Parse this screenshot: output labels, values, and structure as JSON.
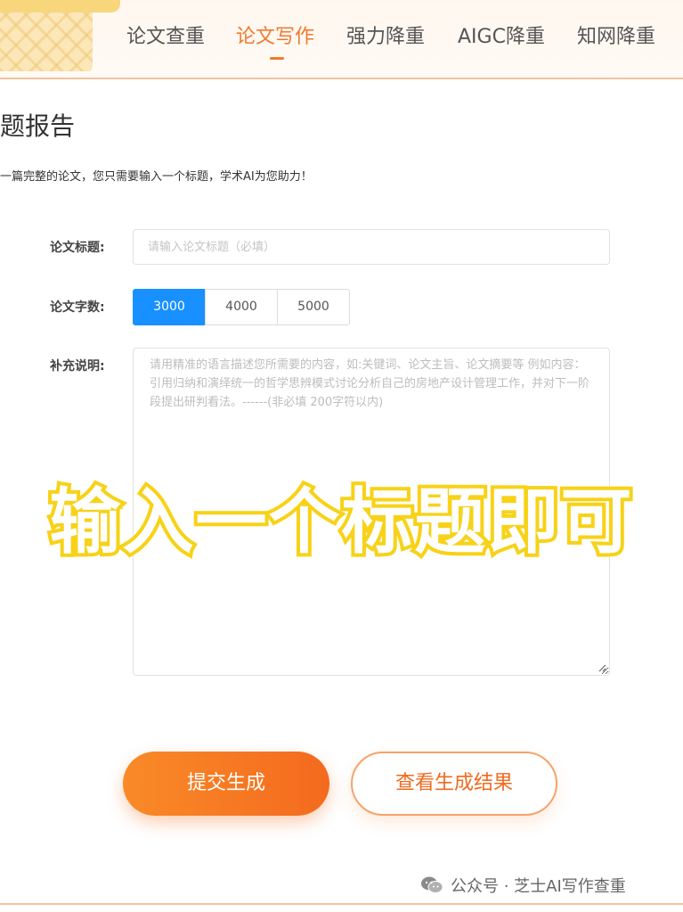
{
  "nav": {
    "items": [
      {
        "label": "论文查重",
        "active": false
      },
      {
        "label": "论文写作",
        "active": true
      },
      {
        "label": "强力降重",
        "active": false
      },
      {
        "label": "AIGC降重",
        "active": false
      },
      {
        "label": "知网降重",
        "active": false
      }
    ],
    "active_color": "#f07a2c"
  },
  "page": {
    "title": "题报告",
    "subtitle": "一篇完整的论文，您只需要输入一个标题，学术AI为您助力！"
  },
  "form": {
    "title_label": "论文标题:",
    "title_placeholder": "请输入论文标题（必填）",
    "title_value": "",
    "count_label": "论文字数:",
    "count_options": [
      "3000",
      "4000",
      "5000"
    ],
    "count_selected": "3000",
    "desc_label": "补充说明:",
    "desc_placeholder": "请用精准的语言描述您所需要的内容，如:关键词、论文主旨、论文摘要等 例如内容：引用归纳和演绎统一的哲学思辨模式讨论分析自己的房地产设计管理工作，并对下一阶段提出研判看法。------(非必填 200字符以内)",
    "desc_value": ""
  },
  "overlay": {
    "caption": "输入一个标题即可"
  },
  "actions": {
    "submit_label": "提交生成",
    "result_label": "查看生成结果"
  },
  "watermark": {
    "icon": "wechat-icon",
    "text": "公众号 · 芝士AI写作查重"
  },
  "colors": {
    "accent": "#f07a2c",
    "selected_blue": "#1890ff",
    "caption_outline": "#f7d21a"
  }
}
